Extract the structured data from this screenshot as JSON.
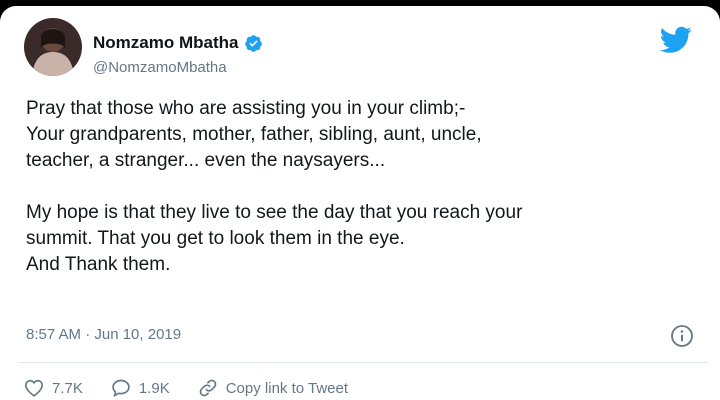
{
  "tweet": {
    "author": {
      "display_name": "Nomzamo Mbatha",
      "handle": "@NomzamoMbatha",
      "verified": true
    },
    "body_lines": [
      "Pray that those who are assisting you in your climb;-",
      "Your grandparents, mother, father, sibling, aunt, uncle,",
      "teacher, a stranger... even the naysayers...",
      "My hope is that they live to see the day that you reach your",
      "summit. That you get to look them in the eye.",
      "And Thank them."
    ],
    "timestamp": "8:57 AM · Jun 10, 2019",
    "likes": "7.7K",
    "replies": "1.9K",
    "copy_link_label": "Copy link to Tweet"
  },
  "colors": {
    "accent": "#1da1f2",
    "text": "#14171a",
    "muted": "#657786"
  },
  "icons": [
    "verified-badge",
    "twitter-bird",
    "info",
    "heart",
    "reply-bubble",
    "link"
  ]
}
